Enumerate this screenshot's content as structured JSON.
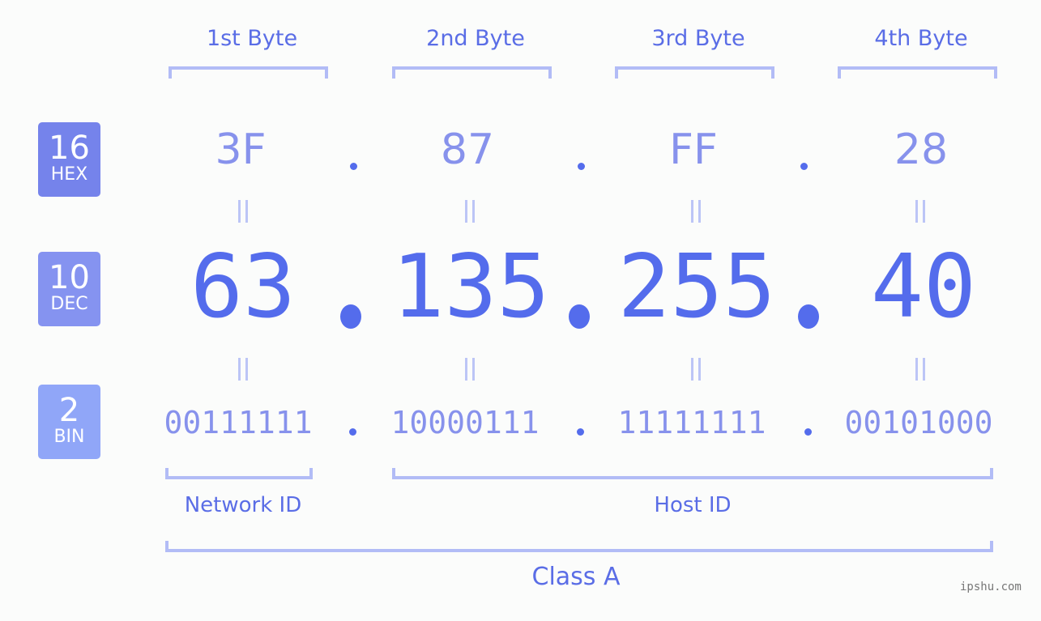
{
  "bytes": {
    "labels": [
      "1st Byte",
      "2nd Byte",
      "3rd Byte",
      "4th Byte"
    ]
  },
  "badges": {
    "hex": {
      "num": "16",
      "unit": "HEX",
      "color": "#7583eb"
    },
    "dec": {
      "num": "10",
      "unit": "DEC",
      "color": "#8593f0"
    },
    "bin": {
      "num": "2",
      "unit": "BIN",
      "color": "#90a6f8"
    }
  },
  "hex_values": [
    "3F",
    "87",
    "FF",
    "28"
  ],
  "dec_values": [
    "63",
    "135",
    "255",
    "40"
  ],
  "bin_values": [
    "00111111",
    "10000111",
    "11111111",
    "00101000"
  ],
  "separator": ".",
  "equals_symbol": "=",
  "network_id_label": "Network ID",
  "host_id_label": "Host ID",
  "class_label": "Class A",
  "watermark": "ipshu.com",
  "colors": {
    "accent": "#546cec",
    "light_accent": "#8792ec",
    "bracket": "#b2bcf6",
    "background": "#fbfcfb"
  }
}
